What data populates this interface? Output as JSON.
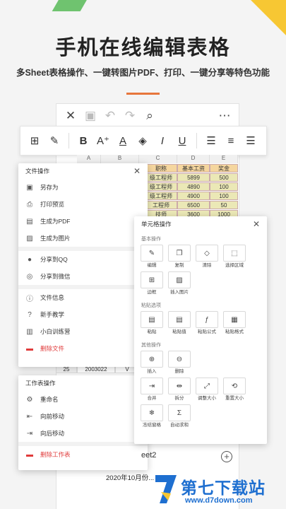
{
  "headline": "手机在线编辑表格",
  "subline": "多Sheet表格操作、一键转图片PDF、打印、一键分享等特色功能",
  "toolbar_icons": [
    "close-icon",
    "save-icon",
    "undo-icon",
    "redo-icon",
    "search-icon",
    "more-icon"
  ],
  "format_icons": [
    "grid-icon",
    "edit-icon",
    "bold-icon",
    "font-size-icon",
    "font-color-icon",
    "fill-color-icon",
    "italic-icon",
    "underline-icon",
    "align-left-icon",
    "align-center-icon",
    "align-right-icon"
  ],
  "sheet": {
    "col_headers": [
      "A",
      "B",
      "C",
      "D",
      "E"
    ],
    "header_row": [
      "职称",
      "基本工资",
      "奖金"
    ],
    "rows": [
      [
        "级工程师",
        "5899",
        "500"
      ],
      [
        "级工程师",
        "4890",
        "100"
      ],
      [
        "级工程师",
        "4900",
        "100"
      ],
      [
        "工程师",
        "6500",
        "50"
      ],
      [
        "技师",
        "3600",
        "1000"
      ]
    ],
    "row_25": {
      "num": "25",
      "value": "2003022",
      "mark": "V"
    },
    "tab_name": "eet2",
    "file_name": "2020年10月份..."
  },
  "file_panel": {
    "title": "文件操作",
    "groups": [
      [
        {
          "icon": "save-as-icon",
          "label": "另存为"
        },
        {
          "icon": "print-icon",
          "label": "打印预览"
        },
        {
          "icon": "pdf-icon",
          "label": "生成为PDF"
        },
        {
          "icon": "image-icon",
          "label": "生成为图片"
        }
      ],
      [
        {
          "icon": "qq-icon",
          "label": "分享到QQ"
        },
        {
          "icon": "wechat-icon",
          "label": "分享到微信"
        }
      ],
      [
        {
          "icon": "info-icon",
          "label": "文件信息"
        },
        {
          "icon": "help-icon",
          "label": "新手教学"
        },
        {
          "icon": "book-icon",
          "label": "小白训练营"
        },
        {
          "icon": "trash-icon",
          "label": "删除文件",
          "danger": true
        }
      ]
    ]
  },
  "sheet_panel": {
    "title": "工作表操作",
    "items": [
      {
        "icon": "rename-icon",
        "label": "重命名"
      },
      {
        "icon": "move-forward-icon",
        "label": "向前移动"
      },
      {
        "icon": "move-back-icon",
        "label": "向后移动"
      },
      {
        "icon": "trash-icon",
        "label": "删除工作表",
        "danger": true
      }
    ]
  },
  "cell_panel": {
    "title": "单元格操作",
    "sections": [
      {
        "title": "基本操作",
        "tiles": [
          {
            "icon": "edit-icon",
            "label": "编辑"
          },
          {
            "icon": "copy-icon",
            "label": "复制"
          },
          {
            "icon": "eraser-icon",
            "label": "清除"
          },
          {
            "icon": "select-area-icon",
            "label": "选择区域"
          },
          {
            "icon": "border-icon",
            "label": "边框"
          },
          {
            "icon": "insert-image-icon",
            "label": "插入图片"
          }
        ]
      },
      {
        "title": "粘贴选项",
        "tiles": [
          {
            "icon": "paste-icon",
            "label": "粘贴"
          },
          {
            "icon": "paste-value-icon",
            "label": "粘贴值"
          },
          {
            "icon": "paste-formula-icon",
            "label": "粘贴公式"
          },
          {
            "icon": "paste-format-icon",
            "label": "粘贴格式"
          }
        ]
      },
      {
        "title": "其他操作",
        "tiles": [
          {
            "icon": "insert-icon",
            "label": "插入"
          },
          {
            "icon": "delete-icon",
            "label": "删除"
          },
          {
            "icon": "merge-icon",
            "label": "合并"
          },
          {
            "icon": "split-icon",
            "label": "拆分"
          },
          {
            "icon": "resize-icon",
            "label": "调整大小"
          },
          {
            "icon": "reset-size-icon",
            "label": "重置大小"
          },
          {
            "icon": "freeze-icon",
            "label": "冻结窗格"
          },
          {
            "icon": "autosum-icon",
            "label": "自动求和"
          }
        ]
      }
    ]
  },
  "watermark": {
    "cn": "第七下载站",
    "url": "www.d7down.com"
  }
}
